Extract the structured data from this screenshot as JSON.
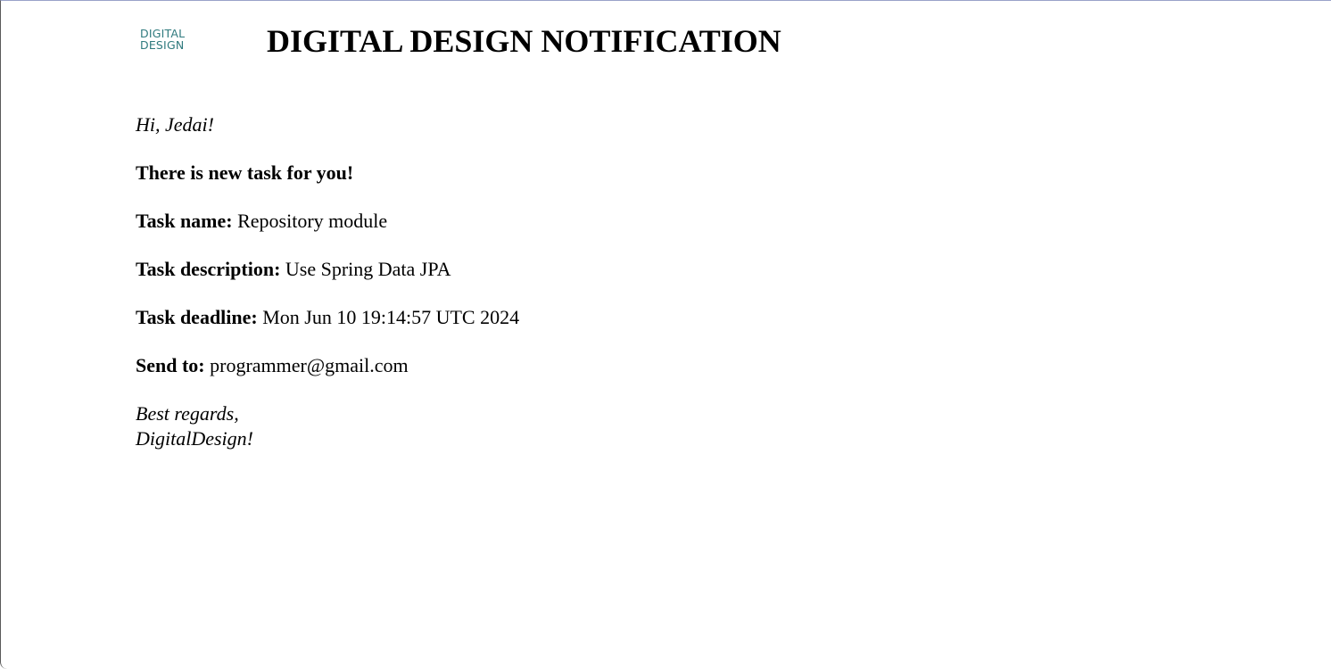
{
  "header": {
    "logo_line1": "DIGITAL",
    "logo_line2": "DESIGN",
    "title": "DIGITAL DESIGN NOTIFICATION"
  },
  "message": {
    "greeting": "Hi, Jedai!",
    "intro": "There is new task for you!",
    "task_name_label": "Task name:",
    "task_name_value": "Repository module",
    "task_description_label": "Task description:",
    "task_description_value": "Use Spring Data JPA",
    "task_deadline_label": "Task deadline:",
    "task_deadline_value": "Mon Jun 10 19:14:57 UTC 2024",
    "send_to_label": "Send to:",
    "send_to_value": "programmer@gmail.com",
    "signoff_line1": "Best regards,",
    "signoff_line2": "DigitalDesign!"
  },
  "colors": {
    "logo": "#2f7a7e",
    "text": "#000000",
    "background": "#ffffff"
  }
}
